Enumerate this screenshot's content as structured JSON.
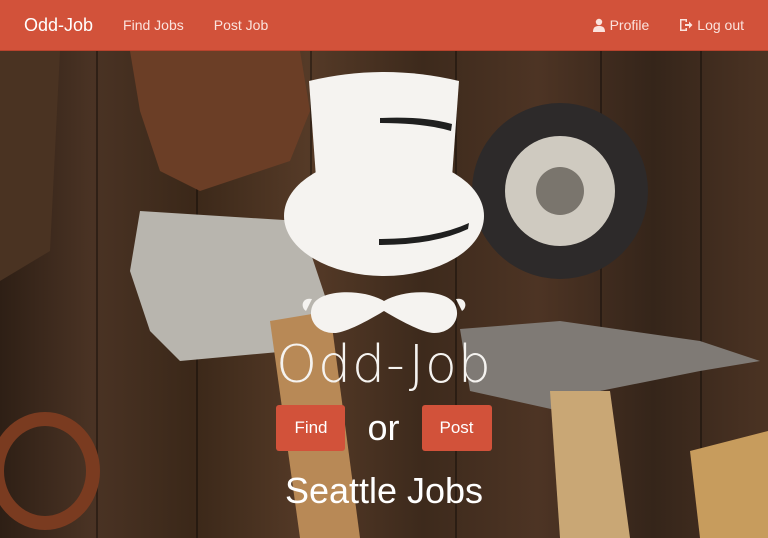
{
  "nav": {
    "brand": "Odd-Job",
    "links": [
      {
        "label": "Find Jobs"
      },
      {
        "label": "Post Job"
      }
    ],
    "right": [
      {
        "label": "Profile",
        "icon": "user-icon"
      },
      {
        "label": "Log out",
        "icon": "logout-icon"
      }
    ]
  },
  "hero": {
    "logo_icon": "top-hat-mustache-icon",
    "title": "Odd-Job",
    "find_label": "Find",
    "or_text": "or",
    "post_label": "Post",
    "subtitle": "Seattle Jobs"
  },
  "colors": {
    "accent": "#d2523a",
    "logo": "#f5f3f0"
  }
}
